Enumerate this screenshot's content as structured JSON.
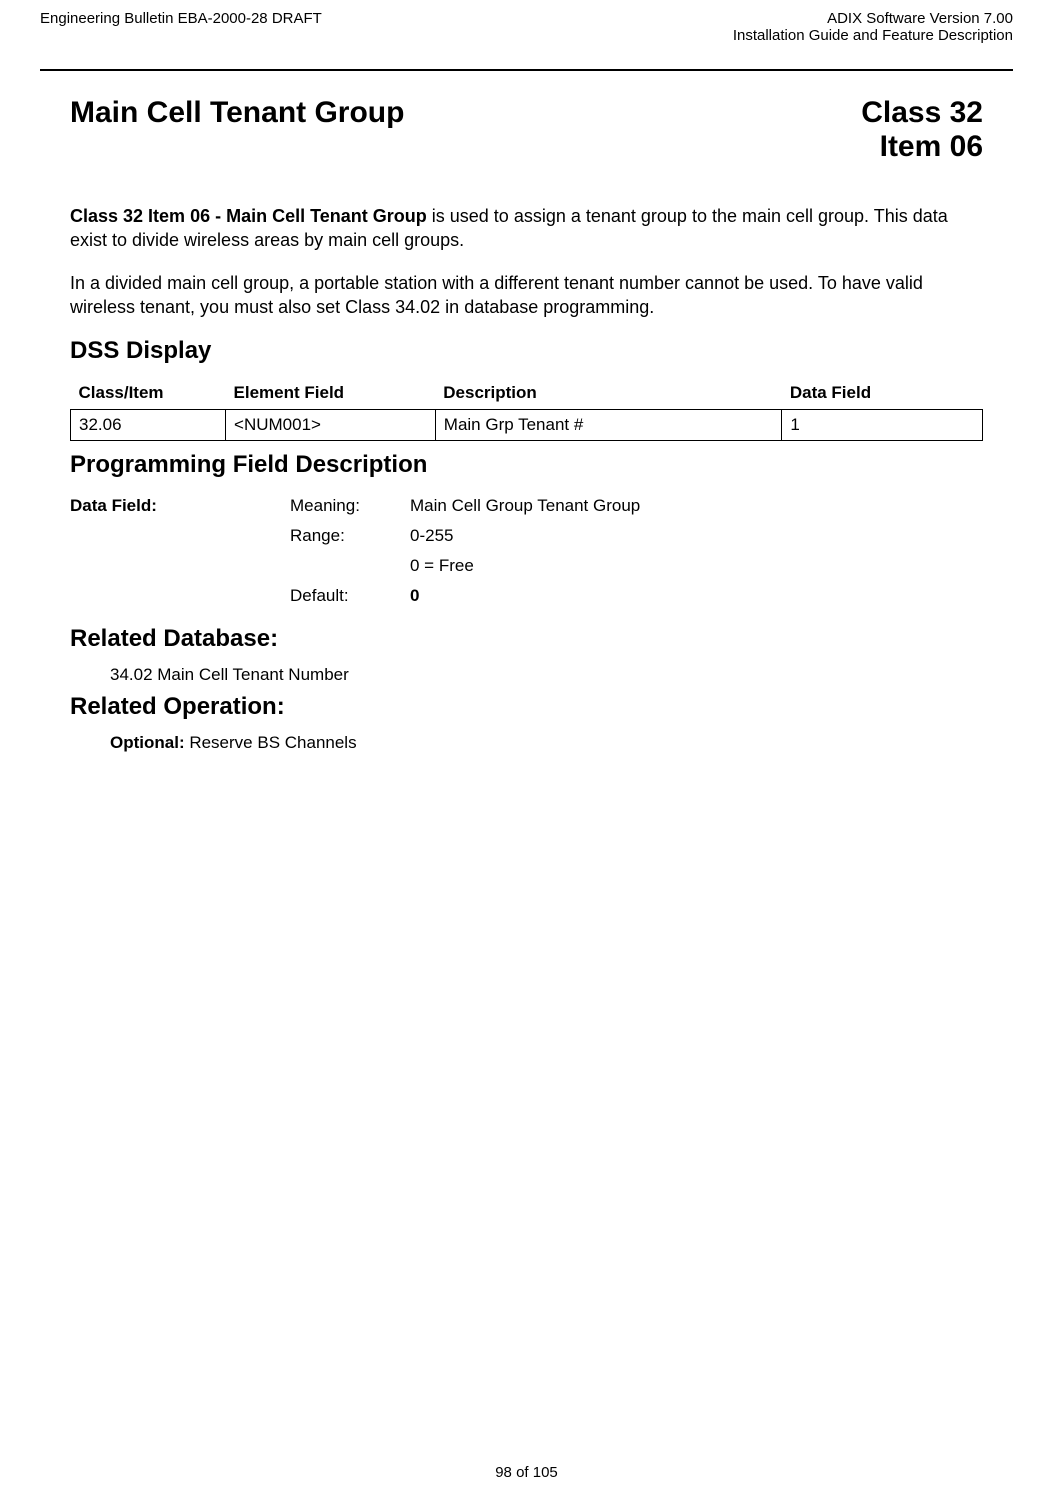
{
  "header": {
    "left": "Engineering Bulletin EBA-2000-28 DRAFT",
    "right_line1": "ADIX Software Version 7.00",
    "right_line2": "Installation Guide and Feature Description"
  },
  "title": {
    "left": "Main Cell Tenant Group",
    "right_line1": "Class 32",
    "right_line2": "Item 06"
  },
  "para1_bold": "Class 32 Item 06 - Main Cell Tenant Group",
  "para1_rest": " is used to assign a tenant group to the main cell group. This data exist to divide wireless areas by main cell groups.",
  "para2": "In a divided main cell group, a portable station with a different tenant number cannot be used. To have valid wireless tenant, you must also set Class 34.02 in database programming.",
  "dss": {
    "heading": "DSS Display",
    "headers": {
      "c1": "Class/Item",
      "c2": "Element Field",
      "c3": "Description",
      "c4": "Data Field"
    },
    "row": {
      "c1": "32.06",
      "c2": "<NUM001>",
      "c3": "Main Grp Tenant #",
      "c4": "1"
    }
  },
  "pfd": {
    "heading": "Programming Field Description",
    "label": "Data Field:",
    "rows": [
      {
        "k": "Meaning:",
        "v": "Main Cell Group Tenant Group"
      },
      {
        "k": "Range:",
        "v": "0-255"
      },
      {
        "k": "",
        "v": "0 = Free"
      },
      {
        "k": "Default:",
        "v": "0",
        "bold": true
      }
    ]
  },
  "related_db": {
    "heading": "Related Database:",
    "item": "34.02 Main Cell Tenant Number"
  },
  "related_op": {
    "heading": "Related Operation:",
    "label": "Optional:  ",
    "value": "Reserve BS Channels"
  },
  "footer": "98 of 105"
}
